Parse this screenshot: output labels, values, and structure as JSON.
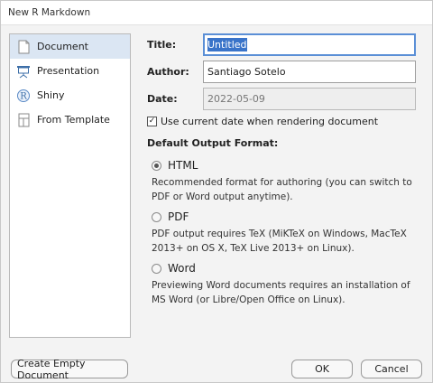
{
  "window": {
    "title": "New R Markdown"
  },
  "sidebar": {
    "items": [
      {
        "label": "Document",
        "icon": "document-icon",
        "selected": true
      },
      {
        "label": "Presentation",
        "icon": "presentation-icon",
        "selected": false
      },
      {
        "label": "Shiny",
        "icon": "shiny-r-icon",
        "selected": false
      },
      {
        "label": "From Template",
        "icon": "template-icon",
        "selected": false
      }
    ]
  },
  "form": {
    "title_label": "Title:",
    "title_value": "Untitled",
    "author_label": "Author:",
    "author_value": "Santiago Sotelo",
    "date_label": "Date:",
    "date_value": "2022-05-09",
    "use_current_date_label": "Use current date when rendering document",
    "use_current_date_checked": true,
    "output_format_label": "Default Output Format:",
    "formats": [
      {
        "label": "HTML",
        "checked": true,
        "description": "Recommended format for authoring (you can switch to PDF or Word output anytime)."
      },
      {
        "label": "PDF",
        "checked": false,
        "description": "PDF output requires TeX (MiKTeX on Windows, MacTeX 2013+ on OS X, TeX Live 2013+ on Linux)."
      },
      {
        "label": "Word",
        "checked": false,
        "description": "Previewing Word documents requires an installation of MS Word (or Libre/Open Office on Linux)."
      }
    ]
  },
  "buttons": {
    "create_empty": "Create Empty Document",
    "ok": "OK",
    "cancel": "Cancel"
  },
  "colors": {
    "selection": "#dbe6f3",
    "focus_border": "#5b8fd6",
    "text_highlight": "#3a74c9"
  }
}
